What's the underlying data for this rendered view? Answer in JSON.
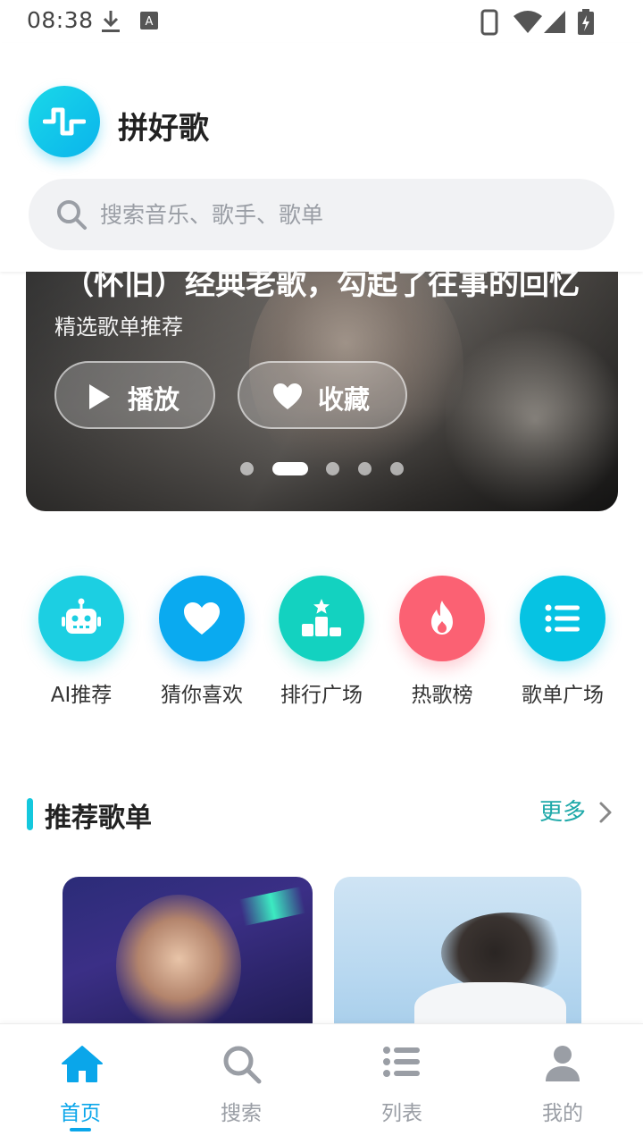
{
  "status_bar": {
    "time": "08:38",
    "left_icons": [
      "download-icon",
      "keyboard-a-icon"
    ],
    "right_icons": [
      "phone-icon",
      "wifi-icon",
      "signal-icon",
      "battery-charging-icon"
    ]
  },
  "header": {
    "app_name": "拼好歌",
    "logo_icon": "soundwave-icon",
    "search_placeholder": "搜索音乐、歌手、歌单"
  },
  "banner": {
    "title": "（怀旧）经典老歌，勾起了往事的回忆",
    "subtitle": "精选歌单推荐",
    "play_label": "播放",
    "favorite_label": "收藏",
    "page_count": 5,
    "active_page": 2
  },
  "quick_access": [
    {
      "label": "AI推荐",
      "icon": "robot-icon",
      "color": "#1ccfe2"
    },
    {
      "label": "猜你喜欢",
      "icon": "heart-icon",
      "color": "#0aaaf0"
    },
    {
      "label": "排行广场",
      "icon": "podium-icon",
      "color": "#13d2c0"
    },
    {
      "label": "热歌榜",
      "icon": "flame-icon",
      "color": "#fb6173"
    },
    {
      "label": "歌单广场",
      "icon": "list-icon",
      "color": "#06c3e3"
    }
  ],
  "section": {
    "title": "推荐歌单",
    "more_label": "更多"
  },
  "bottom_nav": [
    {
      "label": "首页",
      "icon": "home-icon",
      "active": true
    },
    {
      "label": "搜索",
      "icon": "search-icon",
      "active": false
    },
    {
      "label": "列表",
      "icon": "list-icon",
      "active": false
    },
    {
      "label": "我的",
      "icon": "user-icon",
      "active": false
    }
  ],
  "colors": {
    "accent": "#0aa6ea",
    "teal": "#14c8dd",
    "more_text": "#1fa9a9"
  }
}
